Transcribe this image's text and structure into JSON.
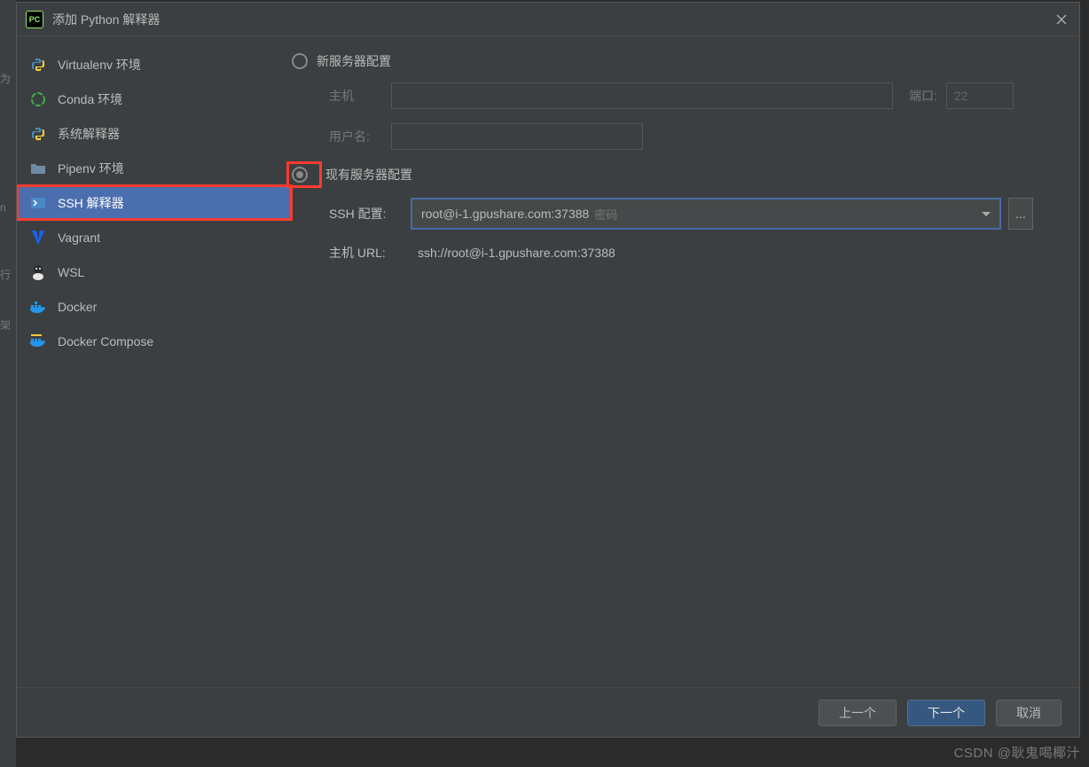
{
  "titlebar": {
    "title": "添加 Python 解释器",
    "app_icon_label": "PC"
  },
  "left_gutter": [
    "为",
    "n",
    "行",
    "架"
  ],
  "sidebar": {
    "items": [
      {
        "label": "Virtualenv 环境",
        "icon": "python-icon",
        "icon_color": "#f0c93e"
      },
      {
        "label": "Conda 环境",
        "icon": "conda-icon",
        "icon_color": "#3eb049"
      },
      {
        "label": "系统解释器",
        "icon": "python-icon",
        "icon_color": "#f0c93e"
      },
      {
        "label": "Pipenv 环境",
        "icon": "folder-icon",
        "icon_color": "#6e8ba3"
      },
      {
        "label": "SSH 解释器",
        "icon": "ssh-icon",
        "icon_color": "#4a88c7"
      },
      {
        "label": "Vagrant",
        "icon": "vagrant-icon",
        "icon_color": "#1563ff"
      },
      {
        "label": "WSL",
        "icon": "linux-icon",
        "icon_color": "#e8e8e8"
      },
      {
        "label": "Docker",
        "icon": "docker-icon",
        "icon_color": "#2496ed"
      },
      {
        "label": "Docker Compose",
        "icon": "docker-compose-icon",
        "icon_color": "#2496ed"
      }
    ],
    "selected_index": 4
  },
  "main": {
    "radio_new_server": "新服务器配置",
    "radio_existing_server": "现有服务器配置",
    "selected_radio": "existing",
    "labels": {
      "host": "主机",
      "port": "端口:",
      "username": "用户名:",
      "ssh_config": "SSH 配置:",
      "host_url": "主机 URL:"
    },
    "values": {
      "host": "",
      "port": "22",
      "username": "",
      "ssh_config_text": "root@i-1.gpushare.com:37388",
      "ssh_config_hint": "密码",
      "host_url": "ssh://root@i-1.gpushare.com:37388"
    },
    "more_button": "..."
  },
  "footer": {
    "prev": "上一个",
    "next": "下一个",
    "cancel": "取消"
  },
  "watermark": "CSDN @耿鬼喝椰汁"
}
